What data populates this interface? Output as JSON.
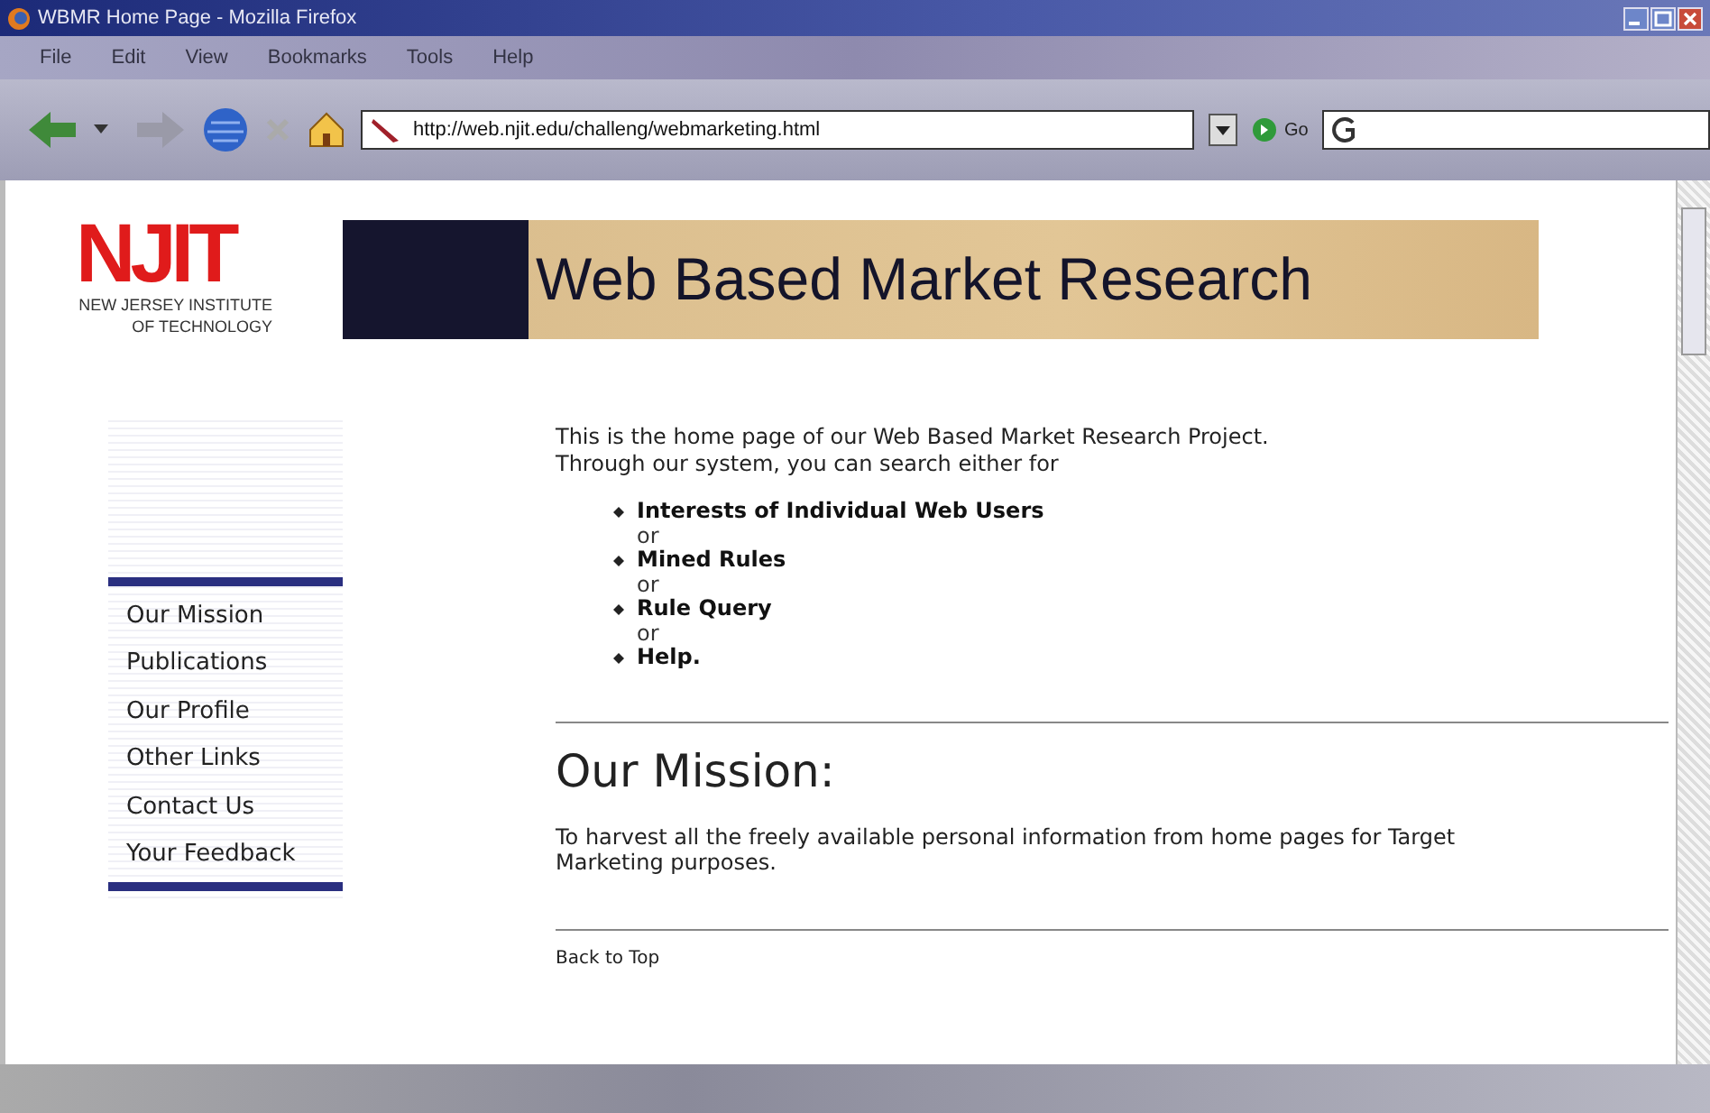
{
  "window": {
    "title": "WBMR Home Page - Mozilla Firefox"
  },
  "menu": [
    "File",
    "Edit",
    "View",
    "Bookmarks",
    "Tools",
    "Help"
  ],
  "toolbar": {
    "address": "http://web.njit.edu/challeng/webmarketing.html",
    "go_label": "Go"
  },
  "logo": {
    "mark": "NJIT",
    "lines": [
      "NEW JERSEY INSTITUTE",
      "OF TECHNOLOGY"
    ]
  },
  "banner": {
    "title": "Web Based Market Research"
  },
  "nav": [
    "Our Mission",
    "Publications",
    "Our Profile",
    "Other Links",
    "Contact Us",
    "Your Feedback"
  ],
  "intro": [
    "This is the home page of our Web Based Market Research Project.",
    "Through our system, you can search either for"
  ],
  "options": [
    {
      "label": "Interests of Individual Web Users",
      "after": "or"
    },
    {
      "label": "Mined Rules",
      "after": "or"
    },
    {
      "label": "Rule Query",
      "after": "or"
    },
    {
      "label": "Help."
    }
  ],
  "mission": {
    "heading": "Our Mission:",
    "lines": [
      "To harvest all the freely available personal information from home pages for Target",
      "Marketing purposes."
    ]
  },
  "back_to_top": "Back to Top"
}
